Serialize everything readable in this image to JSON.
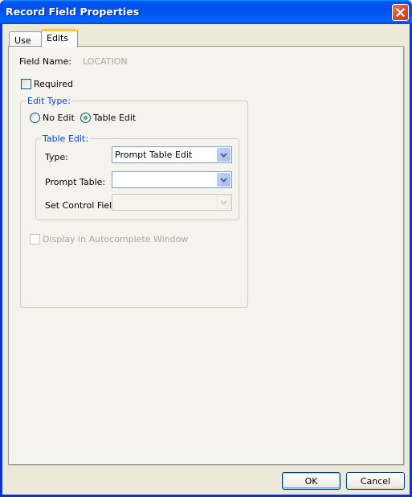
{
  "window": {
    "title": "Record Field Properties",
    "close_icon": "close-x-icon"
  },
  "tabs": [
    {
      "label": "Use",
      "active": false
    },
    {
      "label": "Edits",
      "active": true
    }
  ],
  "field_name": {
    "label": "Field Name:",
    "value": "LOCATION"
  },
  "required": {
    "label": "Required",
    "checked": false
  },
  "edit_type": {
    "group_label": "Edit Type:",
    "options": [
      {
        "label": "No Edit",
        "selected": false
      },
      {
        "label": "Table Edit",
        "selected": true
      }
    ]
  },
  "table_edit": {
    "group_label": "Table Edit:",
    "type": {
      "label": "Type:",
      "value": "Prompt Table Edit"
    },
    "prompt_table": {
      "label": "Prompt Table:",
      "value": ""
    },
    "set_control_field": {
      "label": "Set Control Field:",
      "value": "",
      "disabled": true
    }
  },
  "autocomplete": {
    "label": "Display in Autocomplete Window",
    "checked": false,
    "disabled": true
  },
  "buttons": {
    "ok": "OK",
    "cancel": "Cancel"
  }
}
